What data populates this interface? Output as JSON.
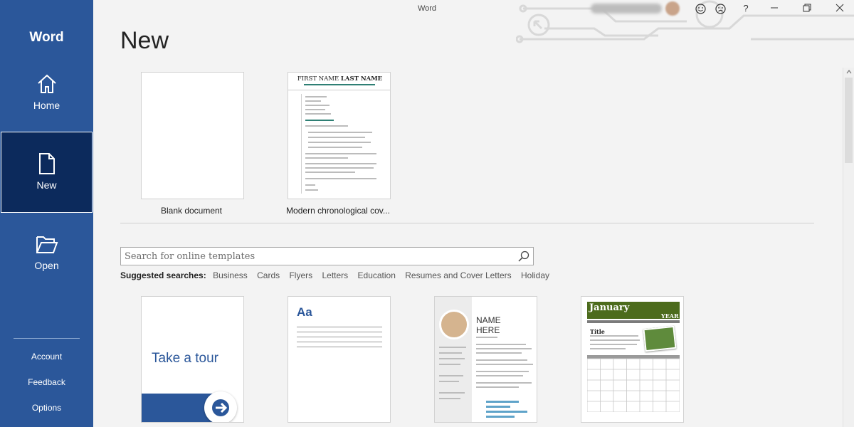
{
  "app": {
    "name": "Word",
    "window_title": "Word"
  },
  "sidebar": {
    "nav": [
      {
        "label": "Home",
        "icon": "home-icon"
      },
      {
        "label": "New",
        "icon": "new-document-icon",
        "selected": true
      },
      {
        "label": "Open",
        "icon": "folder-open-icon"
      }
    ],
    "links": {
      "account": "Account",
      "feedback": "Feedback",
      "options": "Options"
    }
  },
  "titlebar": {
    "help": "?"
  },
  "main": {
    "title": "New",
    "featured": [
      {
        "label": "Blank document"
      },
      {
        "label": "Modern chronological cov...",
        "preview_heading_first": "FIRST NAME ",
        "preview_heading_last": "LAST NAME"
      }
    ],
    "search": {
      "placeholder": "Search for online templates"
    },
    "suggested": {
      "label": "Suggested searches:",
      "items": [
        "Business",
        "Cards",
        "Flyers",
        "Letters",
        "Education",
        "Resumes and Cover Letters",
        "Holiday"
      ]
    },
    "templates": [
      {
        "text": "Take a tour"
      },
      {
        "text": "Aa"
      },
      {
        "name_line1": "NAME",
        "name_line2": "HERE"
      },
      {
        "month": "January",
        "year": "YEAR",
        "title": "Title"
      }
    ]
  },
  "colors": {
    "brand": "#2b579a",
    "selected_nav": "#0c2a5c",
    "calendar_header": "#4c6b1c",
    "cover_accent": "#2e7f74"
  }
}
